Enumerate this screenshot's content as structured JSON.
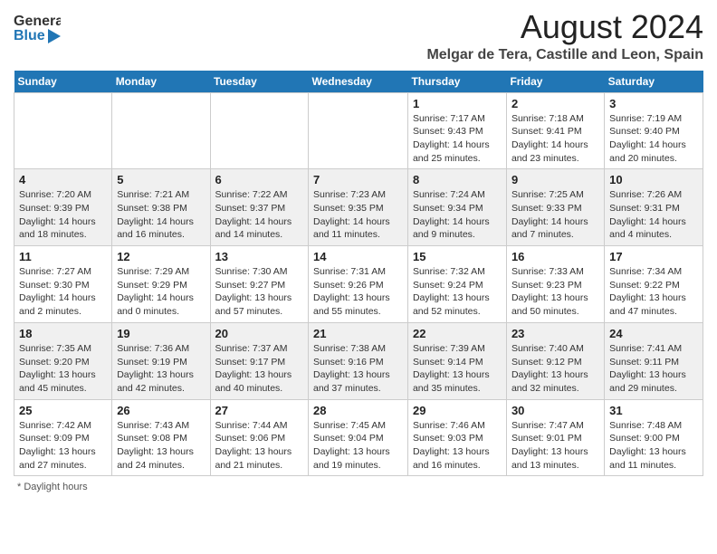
{
  "header": {
    "logo_line1": "General",
    "logo_line2": "Blue",
    "month": "August 2024",
    "location": "Melgar de Tera, Castille and Leon, Spain"
  },
  "weekdays": [
    "Sunday",
    "Monday",
    "Tuesday",
    "Wednesday",
    "Thursday",
    "Friday",
    "Saturday"
  ],
  "weeks": [
    [
      {
        "num": "",
        "info": ""
      },
      {
        "num": "",
        "info": ""
      },
      {
        "num": "",
        "info": ""
      },
      {
        "num": "",
        "info": ""
      },
      {
        "num": "1",
        "info": "Sunrise: 7:17 AM\nSunset: 9:43 PM\nDaylight: 14 hours and 25 minutes."
      },
      {
        "num": "2",
        "info": "Sunrise: 7:18 AM\nSunset: 9:41 PM\nDaylight: 14 hours and 23 minutes."
      },
      {
        "num": "3",
        "info": "Sunrise: 7:19 AM\nSunset: 9:40 PM\nDaylight: 14 hours and 20 minutes."
      }
    ],
    [
      {
        "num": "4",
        "info": "Sunrise: 7:20 AM\nSunset: 9:39 PM\nDaylight: 14 hours and 18 minutes."
      },
      {
        "num": "5",
        "info": "Sunrise: 7:21 AM\nSunset: 9:38 PM\nDaylight: 14 hours and 16 minutes."
      },
      {
        "num": "6",
        "info": "Sunrise: 7:22 AM\nSunset: 9:37 PM\nDaylight: 14 hours and 14 minutes."
      },
      {
        "num": "7",
        "info": "Sunrise: 7:23 AM\nSunset: 9:35 PM\nDaylight: 14 hours and 11 minutes."
      },
      {
        "num": "8",
        "info": "Sunrise: 7:24 AM\nSunset: 9:34 PM\nDaylight: 14 hours and 9 minutes."
      },
      {
        "num": "9",
        "info": "Sunrise: 7:25 AM\nSunset: 9:33 PM\nDaylight: 14 hours and 7 minutes."
      },
      {
        "num": "10",
        "info": "Sunrise: 7:26 AM\nSunset: 9:31 PM\nDaylight: 14 hours and 4 minutes."
      }
    ],
    [
      {
        "num": "11",
        "info": "Sunrise: 7:27 AM\nSunset: 9:30 PM\nDaylight: 14 hours and 2 minutes."
      },
      {
        "num": "12",
        "info": "Sunrise: 7:29 AM\nSunset: 9:29 PM\nDaylight: 14 hours and 0 minutes."
      },
      {
        "num": "13",
        "info": "Sunrise: 7:30 AM\nSunset: 9:27 PM\nDaylight: 13 hours and 57 minutes."
      },
      {
        "num": "14",
        "info": "Sunrise: 7:31 AM\nSunset: 9:26 PM\nDaylight: 13 hours and 55 minutes."
      },
      {
        "num": "15",
        "info": "Sunrise: 7:32 AM\nSunset: 9:24 PM\nDaylight: 13 hours and 52 minutes."
      },
      {
        "num": "16",
        "info": "Sunrise: 7:33 AM\nSunset: 9:23 PM\nDaylight: 13 hours and 50 minutes."
      },
      {
        "num": "17",
        "info": "Sunrise: 7:34 AM\nSunset: 9:22 PM\nDaylight: 13 hours and 47 minutes."
      }
    ],
    [
      {
        "num": "18",
        "info": "Sunrise: 7:35 AM\nSunset: 9:20 PM\nDaylight: 13 hours and 45 minutes."
      },
      {
        "num": "19",
        "info": "Sunrise: 7:36 AM\nSunset: 9:19 PM\nDaylight: 13 hours and 42 minutes."
      },
      {
        "num": "20",
        "info": "Sunrise: 7:37 AM\nSunset: 9:17 PM\nDaylight: 13 hours and 40 minutes."
      },
      {
        "num": "21",
        "info": "Sunrise: 7:38 AM\nSunset: 9:16 PM\nDaylight: 13 hours and 37 minutes."
      },
      {
        "num": "22",
        "info": "Sunrise: 7:39 AM\nSunset: 9:14 PM\nDaylight: 13 hours and 35 minutes."
      },
      {
        "num": "23",
        "info": "Sunrise: 7:40 AM\nSunset: 9:12 PM\nDaylight: 13 hours and 32 minutes."
      },
      {
        "num": "24",
        "info": "Sunrise: 7:41 AM\nSunset: 9:11 PM\nDaylight: 13 hours and 29 minutes."
      }
    ],
    [
      {
        "num": "25",
        "info": "Sunrise: 7:42 AM\nSunset: 9:09 PM\nDaylight: 13 hours and 27 minutes."
      },
      {
        "num": "26",
        "info": "Sunrise: 7:43 AM\nSunset: 9:08 PM\nDaylight: 13 hours and 24 minutes."
      },
      {
        "num": "27",
        "info": "Sunrise: 7:44 AM\nSunset: 9:06 PM\nDaylight: 13 hours and 21 minutes."
      },
      {
        "num": "28",
        "info": "Sunrise: 7:45 AM\nSunset: 9:04 PM\nDaylight: 13 hours and 19 minutes."
      },
      {
        "num": "29",
        "info": "Sunrise: 7:46 AM\nSunset: 9:03 PM\nDaylight: 13 hours and 16 minutes."
      },
      {
        "num": "30",
        "info": "Sunrise: 7:47 AM\nSunset: 9:01 PM\nDaylight: 13 hours and 13 minutes."
      },
      {
        "num": "31",
        "info": "Sunrise: 7:48 AM\nSunset: 9:00 PM\nDaylight: 13 hours and 11 minutes."
      }
    ]
  ],
  "footer": {
    "note": "Daylight hours"
  }
}
